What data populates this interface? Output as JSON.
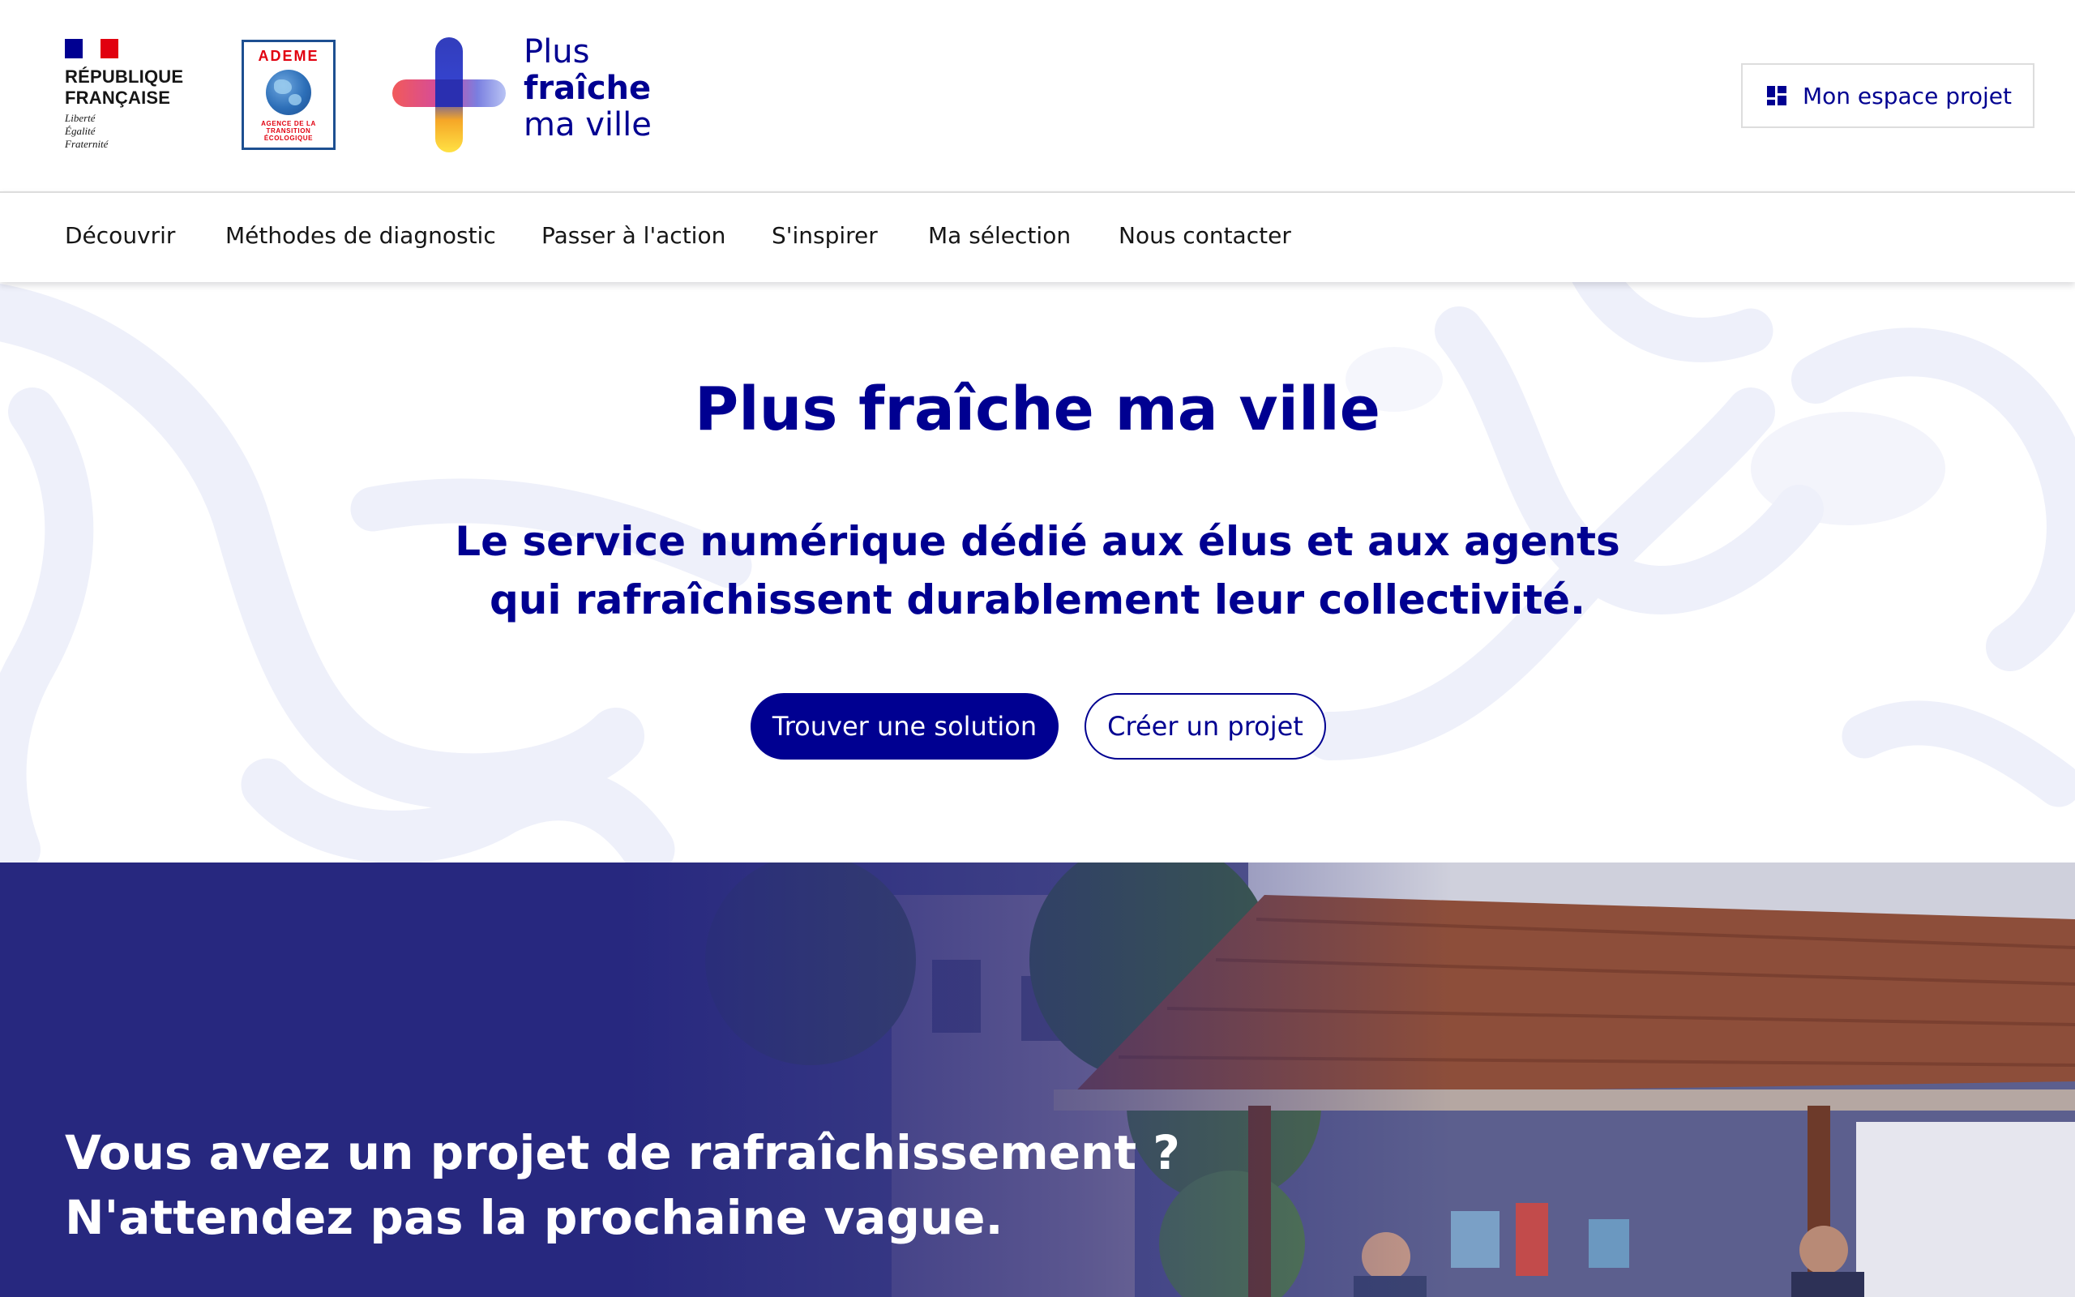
{
  "header": {
    "republique": {
      "name": "RÉPUBLIQUE\nFRANÇAISE",
      "motto": "Liberté\nÉgalité\nFraternité"
    },
    "ademe": {
      "title": "ADEME",
      "subtitle": "AGENCE DE LA\nTRANSITION\nÉCOLOGIQUE"
    },
    "site_name": {
      "line1": "Plus",
      "line2": "fraîche",
      "line3": "ma ville"
    },
    "espace_button": "Mon espace projet"
  },
  "nav": {
    "items": [
      {
        "label": "Découvrir"
      },
      {
        "label": "Méthodes de diagnostic"
      },
      {
        "label": "Passer à l'action"
      },
      {
        "label": "S'inspirer"
      },
      {
        "label": "Ma sélection"
      },
      {
        "label": "Nous contacter"
      }
    ]
  },
  "hero": {
    "title_part1": "Plus ",
    "title_bold": "fraîche",
    "title_part2": " ma ville",
    "subtitle_line1": "Le service numérique dédié aux élus et aux agents",
    "subtitle_line2": "qui rafraîchissent durablement leur collectivité.",
    "primary_button": "Trouver une solution",
    "secondary_button": "Créer un projet"
  },
  "banner": {
    "line1": "Vous avez un projet de rafraîchissement ?",
    "line2": "N'attendez pas la prochaine vague."
  },
  "colors": {
    "brand_blue": "#000091",
    "banner_blue": "#27287f",
    "hero_shape": "#eef0fa",
    "marianne_red": "#e1000f"
  }
}
